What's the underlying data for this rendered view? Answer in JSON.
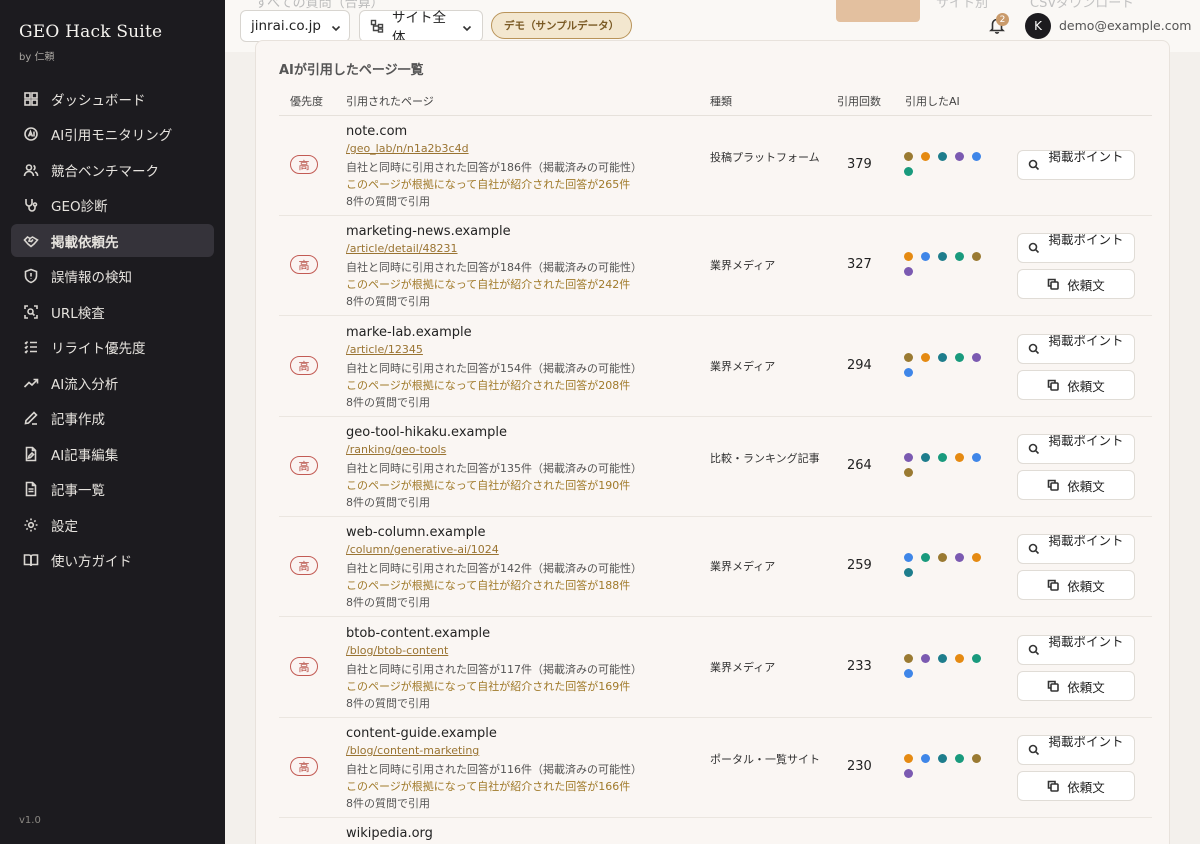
{
  "app": {
    "name": "GEO Hack Suite",
    "byline": "by 仁頼",
    "version": "v1.0"
  },
  "sidebar": {
    "items": [
      {
        "label": "ダッシュボード",
        "icon": "grid-icon",
        "active": false
      },
      {
        "label": "AI引用モニタリング",
        "icon": "ai-icon",
        "active": false
      },
      {
        "label": "競合ベンチマーク",
        "icon": "users-icon",
        "active": false
      },
      {
        "label": "GEO診断",
        "icon": "stethoscope-icon",
        "active": false
      },
      {
        "label": "掲載依頼先",
        "icon": "handshake-icon",
        "active": true
      },
      {
        "label": "誤情報の検知",
        "icon": "shield-icon",
        "active": false
      },
      {
        "label": "URL検査",
        "icon": "scan-icon",
        "active": false
      },
      {
        "label": "リライト優先度",
        "icon": "list-checks-icon",
        "active": false
      },
      {
        "label": "AI流入分析",
        "icon": "trend-icon",
        "active": false
      },
      {
        "label": "記事作成",
        "icon": "pencil-icon",
        "active": false
      },
      {
        "label": "AI記事編集",
        "icon": "file-edit-icon",
        "active": false
      },
      {
        "label": "記事一覧",
        "icon": "file-list-icon",
        "active": false
      },
      {
        "label": "設定",
        "icon": "gear-icon",
        "active": false
      },
      {
        "label": "使い方ガイド",
        "icon": "book-icon",
        "active": false
      }
    ]
  },
  "topbar": {
    "ghost_filter": "すべての質問（合算）",
    "ghost_tab": "サイト別",
    "ghost_csv": "CSVダウンロード",
    "domain_select": "jinrai.co.jp",
    "scope_select": "サイト全体",
    "demo_badge": "デモ（サンプルデータ）",
    "notification_count": "2",
    "avatar_initial": "K",
    "user_email": "demo@example.com"
  },
  "table": {
    "title": "AIが引用したページ一覧",
    "headers": {
      "priority": "優先度",
      "page": "引用されたページ",
      "type": "種類",
      "count": "引用回数",
      "ai": "引用したAI"
    },
    "point_button": "掲載ポイント",
    "request_button": "依頼文",
    "rows": [
      {
        "priority": "高",
        "domain": "note.com",
        "path": "/geo_lab/n/n1a2b3c4d",
        "line1": "自社と同時に引用された回答が186件（掲載済みの可能性）",
        "line2": "このページが根拠になって自社が紹介された回答が265件",
        "line3": "8件の質問で引用",
        "type": "投稿プラットフォーム",
        "count": "379",
        "dots": [
          "#9a7a32",
          "#e58a12",
          "#1e7d8c",
          "#7b5ab1",
          "#3f86e8",
          "#199a7d"
        ],
        "has_request": false
      },
      {
        "priority": "高",
        "domain": "marketing-news.example",
        "path": "/article/detail/48231",
        "line1": "自社と同時に引用された回答が184件（掲載済みの可能性）",
        "line2": "このページが根拠になって自社が紹介された回答が242件",
        "line3": "8件の質問で引用",
        "type": "業界メディア",
        "count": "327",
        "dots": [
          "#e58a12",
          "#3f86e8",
          "#1e7d8c",
          "#199a7d",
          "#9a7a32",
          "#7b5ab1"
        ],
        "has_request": true
      },
      {
        "priority": "高",
        "domain": "marke-lab.example",
        "path": "/article/12345",
        "line1": "自社と同時に引用された回答が154件（掲載済みの可能性）",
        "line2": "このページが根拠になって自社が紹介された回答が208件",
        "line3": "8件の質問で引用",
        "type": "業界メディア",
        "count": "294",
        "dots": [
          "#9a7a32",
          "#e58a12",
          "#1e7d8c",
          "#199a7d",
          "#7b5ab1",
          "#3f86e8"
        ],
        "has_request": true
      },
      {
        "priority": "高",
        "domain": "geo-tool-hikaku.example",
        "path": "/ranking/geo-tools",
        "line1": "自社と同時に引用された回答が135件（掲載済みの可能性）",
        "line2": "このページが根拠になって自社が紹介された回答が190件",
        "line3": "8件の質問で引用",
        "type": "比較・ランキング記事",
        "count": "264",
        "dots": [
          "#7b5ab1",
          "#1e7d8c",
          "#199a7d",
          "#e58a12",
          "#3f86e8",
          "#9a7a32"
        ],
        "has_request": true
      },
      {
        "priority": "高",
        "domain": "web-column.example",
        "path": "/column/generative-ai/1024",
        "line1": "自社と同時に引用された回答が142件（掲載済みの可能性）",
        "line2": "このページが根拠になって自社が紹介された回答が188件",
        "line3": "8件の質問で引用",
        "type": "業界メディア",
        "count": "259",
        "dots": [
          "#3f86e8",
          "#199a7d",
          "#9a7a32",
          "#7b5ab1",
          "#e58a12",
          "#1e7d8c"
        ],
        "has_request": true
      },
      {
        "priority": "高",
        "domain": "btob-content.example",
        "path": "/blog/btob-content",
        "line1": "自社と同時に引用された回答が117件（掲載済みの可能性）",
        "line2": "このページが根拠になって自社が紹介された回答が169件",
        "line3": "8件の質問で引用",
        "type": "業界メディア",
        "count": "233",
        "dots": [
          "#9a7a32",
          "#7b5ab1",
          "#1e7d8c",
          "#e58a12",
          "#199a7d",
          "#3f86e8"
        ],
        "has_request": true
      },
      {
        "priority": "高",
        "domain": "content-guide.example",
        "path": "/blog/content-marketing",
        "line1": "自社と同時に引用された回答が116件（掲載済みの可能性）",
        "line2": "このページが根拠になって自社が紹介された回答が166件",
        "line3": "8件の質問で引用",
        "type": "ポータル・一覧サイト",
        "count": "230",
        "dots": [
          "#e58a12",
          "#3f86e8",
          "#1e7d8c",
          "#199a7d",
          "#9a7a32",
          "#7b5ab1"
        ],
        "has_request": true
      }
    ],
    "next_row_domain": "wikipedia.org"
  }
}
